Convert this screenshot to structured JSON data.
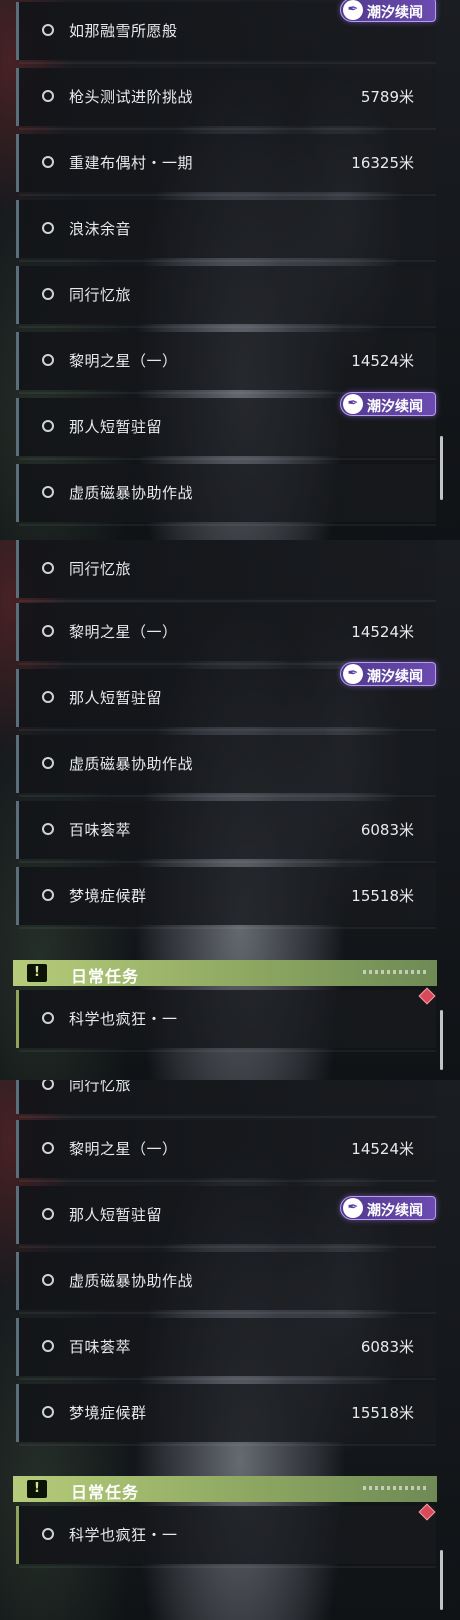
{
  "panel1": {
    "rows": [
      {
        "name": "如那融雪所愿般",
        "distance": ""
      },
      {
        "name": "枪头测试进阶挑战",
        "distance": "5789米"
      },
      {
        "name": "重建布偶村・一期",
        "distance": "16325米"
      },
      {
        "name": "浪沫余音",
        "distance": ""
      },
      {
        "name": "同行忆旅",
        "distance": ""
      },
      {
        "name": "黎明之星（一）",
        "distance": "14524米"
      },
      {
        "name": "那人短暂驻留",
        "distance": ""
      },
      {
        "name": "虚质磁暴协助作战",
        "distance": ""
      }
    ]
  },
  "panel2": {
    "rows": [
      {
        "name": "同行忆旅",
        "distance": ""
      },
      {
        "name": "黎明之星（一）",
        "distance": "14524米"
      },
      {
        "name": "那人短暂驻留",
        "distance": ""
      },
      {
        "name": "虚质磁暴协助作战",
        "distance": ""
      },
      {
        "name": "百味荟萃",
        "distance": "6083米"
      },
      {
        "name": "梦境症候群",
        "distance": "15518米"
      }
    ],
    "daily_rows": [
      {
        "name": "科学也疯狂・一",
        "distance": ""
      }
    ]
  },
  "panel3": {
    "rows": [
      {
        "name": "同行忆旅",
        "distance": ""
      },
      {
        "name": "黎明之星（一）",
        "distance": "14524米"
      },
      {
        "name": "那人短暂驻留",
        "distance": ""
      },
      {
        "name": "虚质磁暴协助作战",
        "distance": ""
      },
      {
        "name": "百味荟萃",
        "distance": "6083米"
      },
      {
        "name": "梦境症候群",
        "distance": "15518米"
      }
    ],
    "daily_rows": [
      {
        "name": "科学也疯狂・一",
        "distance": ""
      }
    ]
  },
  "badge": {
    "label": "潮汐续闻",
    "icon": "feather-icon"
  },
  "daily_section": {
    "title": "日常任务",
    "icon": "exclamation-icon"
  },
  "colors": {
    "badge_purple": "#6c4bb0",
    "daily_green": "#b6cc7a",
    "row_accent": "#5b6f7a",
    "marker_red": "#d84a5a"
  }
}
